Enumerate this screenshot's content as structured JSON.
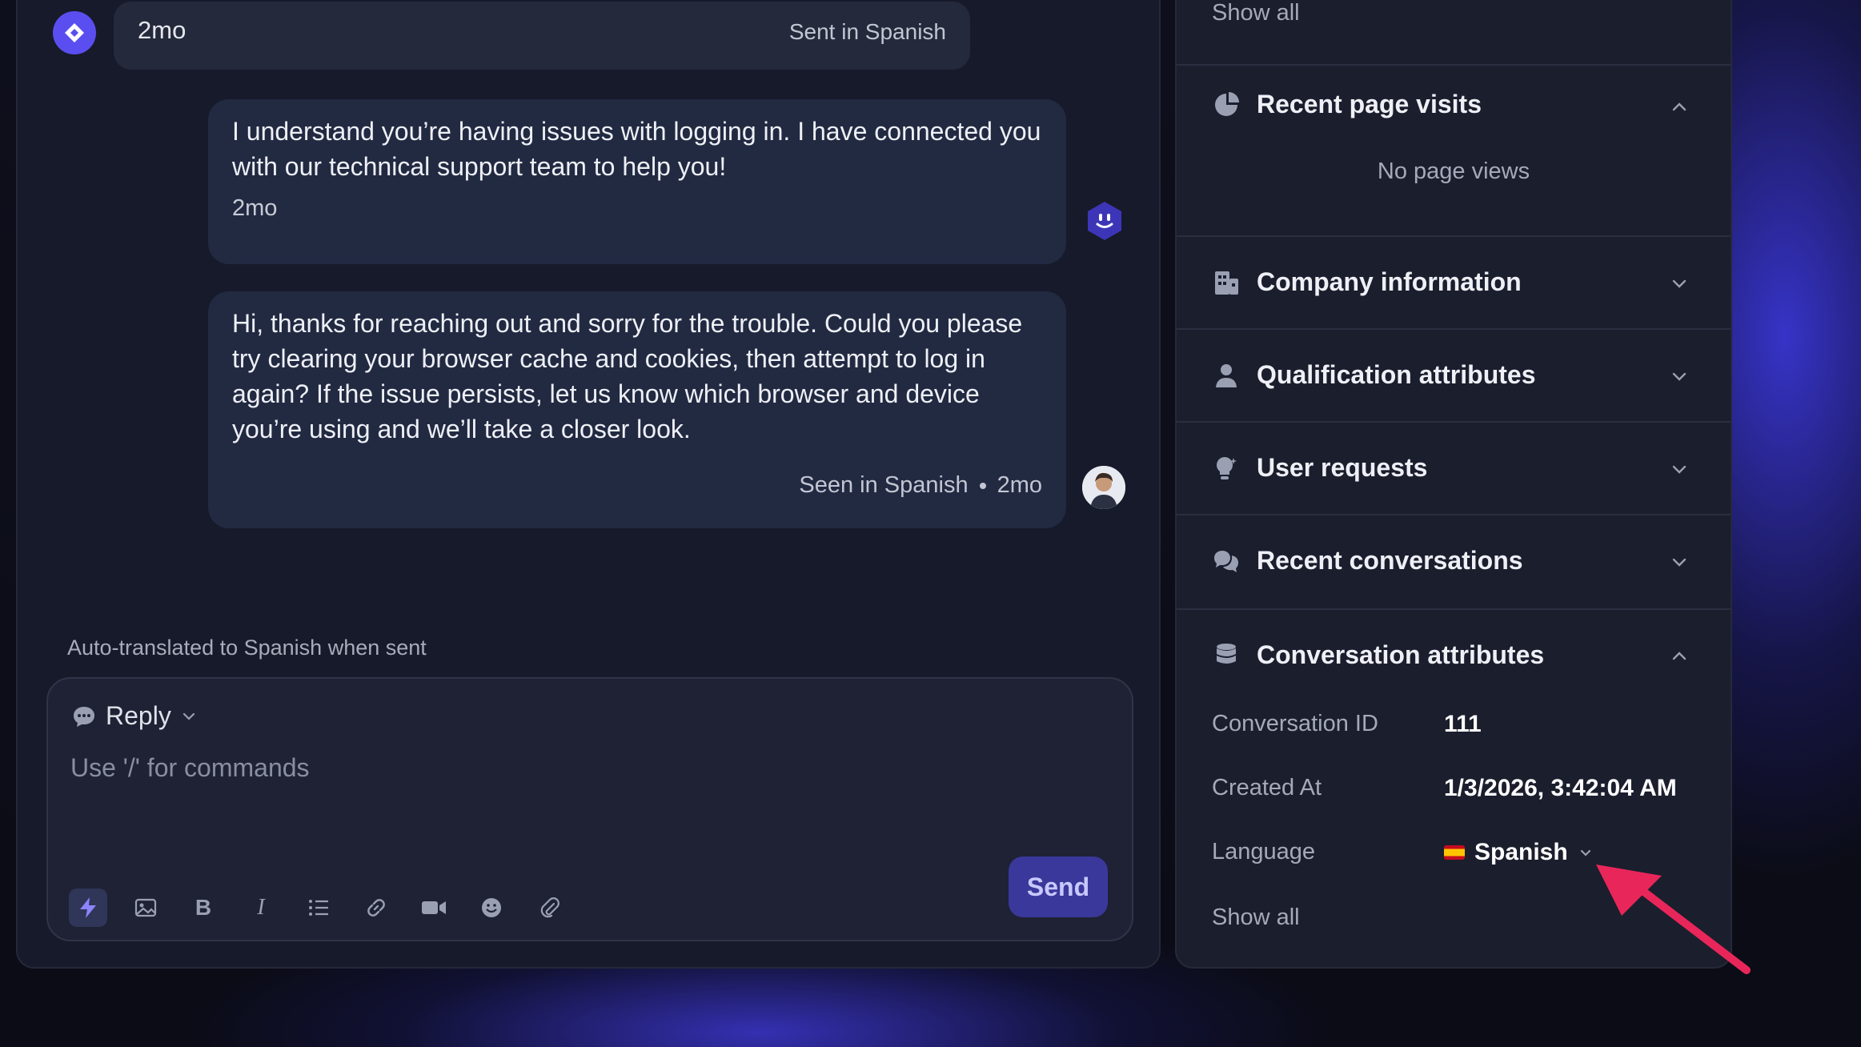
{
  "chat": {
    "top_message": {
      "time": "2mo",
      "status": "Sent in Spanish"
    },
    "bot_message": {
      "text": "I understand you’re having issues with logging in. I have connected you with our technical support team to help you!",
      "time": "2mo"
    },
    "agent_message": {
      "text": "Hi, thanks for reaching out and sorry for the trouble. Could you please try clearing your browser cache and cookies, then attempt to log in again? If the issue persists, let us know which browser and device you’re using and we’ll take a closer look.",
      "status": "Seen in Spanish",
      "time": "2mo"
    },
    "translation_note": "Auto-translated to Spanish when sent"
  },
  "composer": {
    "mode_label": "Reply",
    "placeholder": "Use '/' for commands",
    "send_label": "Send",
    "tools": [
      "lightning-icon",
      "image-icon",
      "bold-icon",
      "italic-icon",
      "list-icon",
      "link-icon",
      "video-icon",
      "emoji-icon",
      "attachment-icon"
    ]
  },
  "sidebar": {
    "top_show_all": "Show all",
    "sections": {
      "recent_page_visits": {
        "title": "Recent page visits",
        "empty": "No page views",
        "expanded": true
      },
      "company_information": {
        "title": "Company information",
        "expanded": false
      },
      "qualification_attributes": {
        "title": "Qualification attributes",
        "expanded": false
      },
      "user_requests": {
        "title": "User requests",
        "expanded": false
      },
      "recent_conversations": {
        "title": "Recent conversations",
        "expanded": false
      },
      "conversation_attributes": {
        "title": "Conversation attributes",
        "expanded": true,
        "rows": {
          "id": {
            "label": "Conversation ID",
            "value": "111"
          },
          "created": {
            "label": "Created At",
            "value": "1/3/2026, 3:42:04 AM"
          },
          "language": {
            "label": "Language",
            "value": "Spanish"
          }
        },
        "show_all": "Show all"
      }
    }
  },
  "colors": {
    "accent": "#5b4ef0",
    "send_bg": "#3a389a",
    "annotation_arrow": "#e8265a"
  }
}
